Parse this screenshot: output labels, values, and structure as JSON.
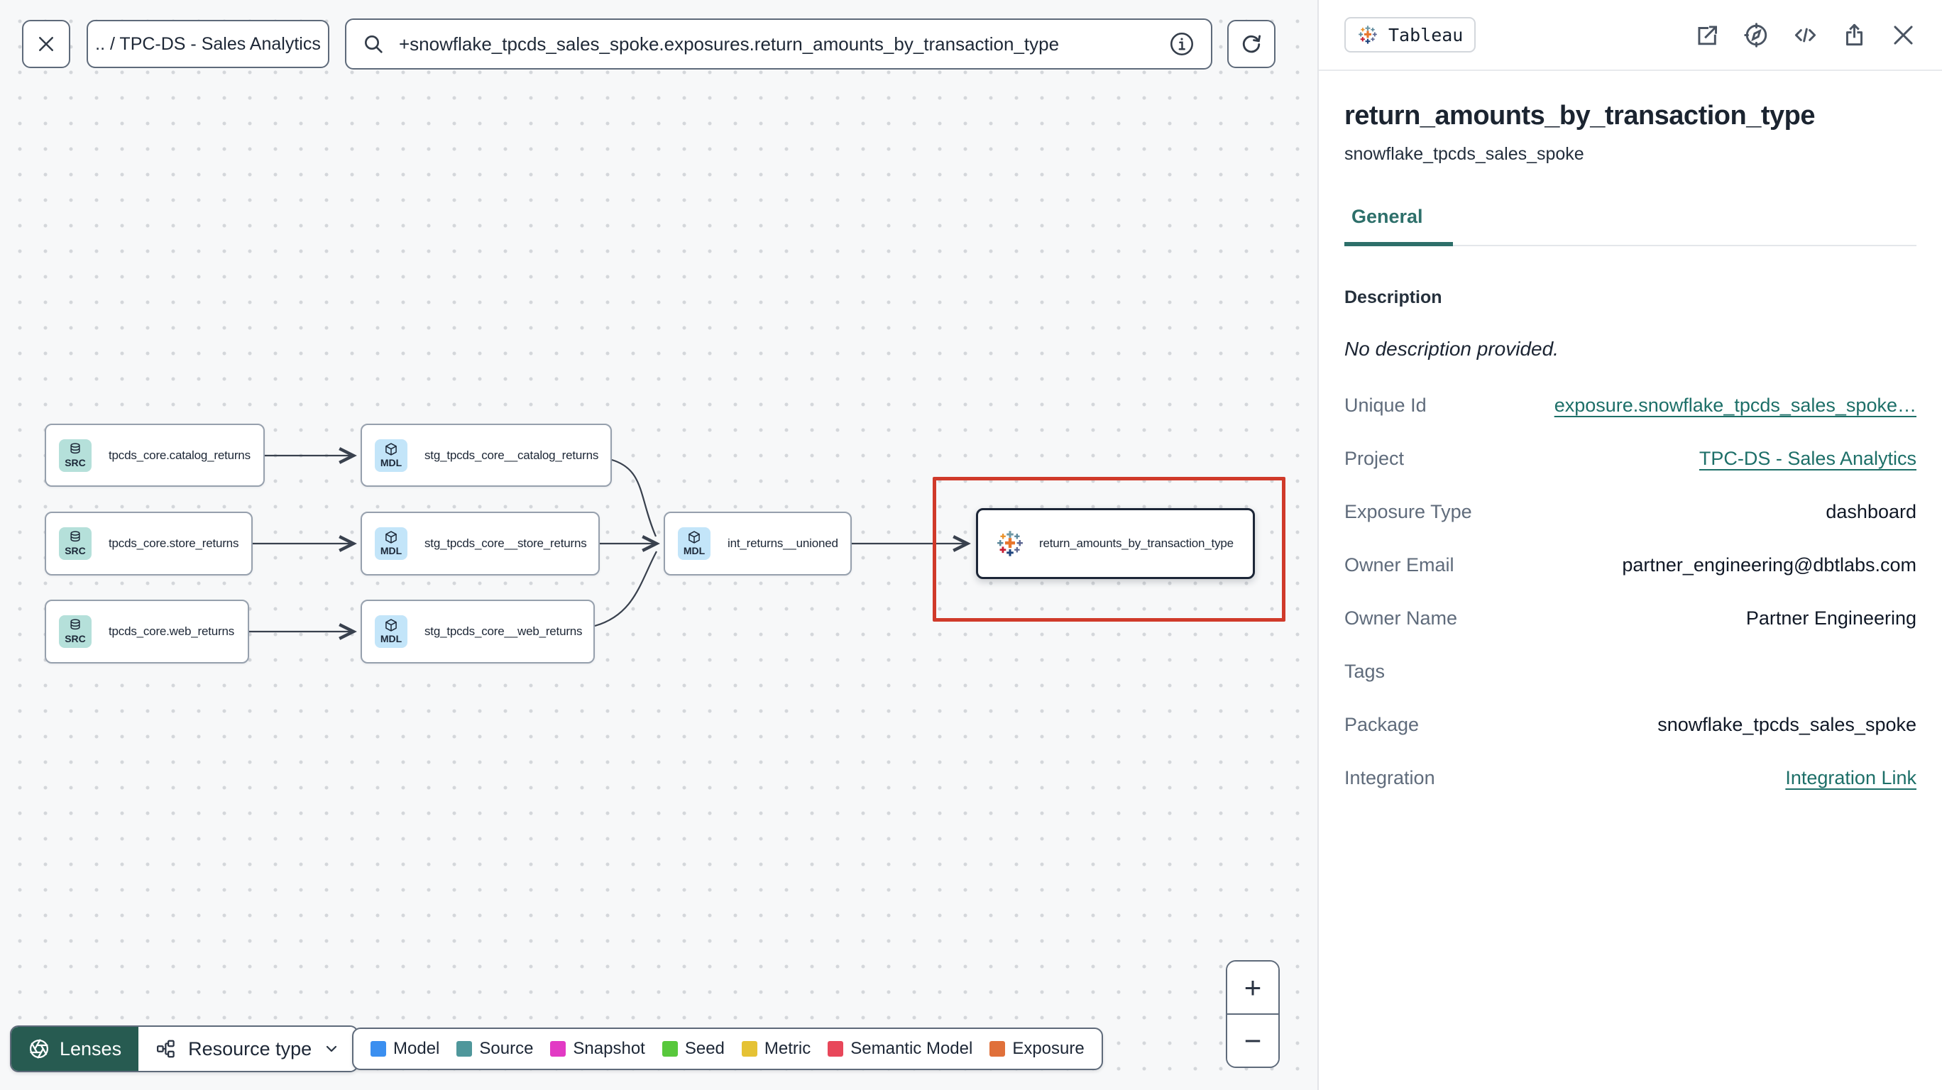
{
  "toolbar": {
    "breadcrumb": ".. / TPC-DS - Sales Analytics",
    "search_value": "+snowflake_tpcds_sales_spoke.exposures.return_amounts_by_transaction_type"
  },
  "graph": {
    "nodes": [
      {
        "label": "tpcds_core.catalog_returns",
        "badge": "SRC",
        "type": "source"
      },
      {
        "label": "tpcds_core.store_returns",
        "badge": "SRC",
        "type": "source"
      },
      {
        "label": "tpcds_core.web_returns",
        "badge": "SRC",
        "type": "source"
      },
      {
        "label": "stg_tpcds_core__catalog_returns",
        "badge": "MDL",
        "type": "model"
      },
      {
        "label": "stg_tpcds_core__store_returns",
        "badge": "MDL",
        "type": "model"
      },
      {
        "label": "stg_tpcds_core__web_returns",
        "badge": "MDL",
        "type": "model"
      },
      {
        "label": "int_returns__unioned",
        "badge": "MDL",
        "type": "model"
      },
      {
        "label": "return_amounts_by_transaction_type",
        "type": "exposure",
        "selected": true
      }
    ]
  },
  "controls": {
    "lenses_label": "Lenses",
    "resource_type_label": "Resource type",
    "zoom_in": "+",
    "zoom_out": "−"
  },
  "legend": {
    "items": [
      {
        "label": "Model",
        "color": "#3b8ff0"
      },
      {
        "label": "Source",
        "color": "#4f979b"
      },
      {
        "label": "Snapshot",
        "color": "#e23ac4"
      },
      {
        "label": "Seed",
        "color": "#58c83c"
      },
      {
        "label": "Metric",
        "color": "#e5c234"
      },
      {
        "label": "Semantic Model",
        "color": "#e8475a"
      },
      {
        "label": "Exposure",
        "color": "#e0703a"
      }
    ]
  },
  "panel": {
    "integration_badge": "Tableau",
    "title": "return_amounts_by_transaction_type",
    "subtitle": "snowflake_tpcds_sales_spoke",
    "active_tab": "General",
    "description_label": "Description",
    "description_value": "No description provided.",
    "rows": [
      {
        "label": "Unique Id",
        "value": "exposure.snowflake_tpcds_sales_spoke…",
        "is_link": true
      },
      {
        "label": "Project",
        "value": "TPC-DS - Sales Analytics",
        "is_link": true
      },
      {
        "label": "Exposure Type",
        "value": "dashboard",
        "is_link": false
      },
      {
        "label": "Owner Email",
        "value": "partner_engineering@dbtlabs.com",
        "is_link": false
      },
      {
        "label": "Owner Name",
        "value": "Partner Engineering",
        "is_link": false
      },
      {
        "label": "Tags",
        "value": "",
        "is_link": false
      },
      {
        "label": "Package",
        "value": "snowflake_tpcds_sales_spoke",
        "is_link": false
      },
      {
        "label": "Integration",
        "value": "Integration Link",
        "is_link": true
      }
    ]
  },
  "colors": {
    "accent_teal": "#2d6f6a",
    "link_teal": "#1d6f68",
    "highlight_red": "#d03a2a",
    "lenses_green": "#275b51",
    "source_badge_bg": "#b5e0da",
    "model_badge_bg": "#c3e5f9",
    "canvas_bg": "#f7f8f9",
    "edge": "#39414e"
  }
}
